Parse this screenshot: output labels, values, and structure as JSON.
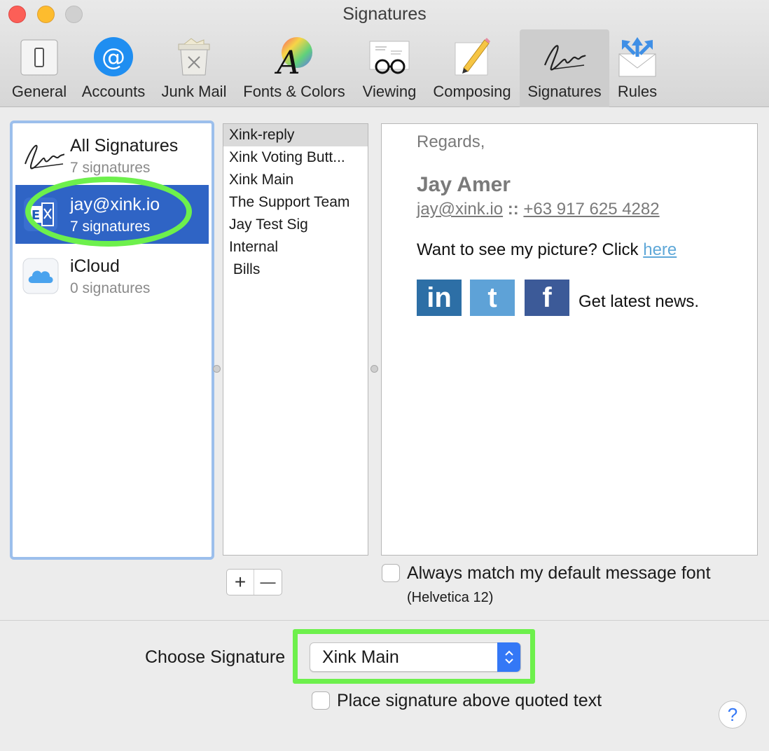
{
  "window": {
    "title": "Signatures"
  },
  "toolbar": {
    "tabs": [
      {
        "label": "General",
        "icon": "general-switch-icon"
      },
      {
        "label": "Accounts",
        "icon": "at-sign-icon"
      },
      {
        "label": "Junk Mail",
        "icon": "junk-trash-icon"
      },
      {
        "label": "Fonts & Colors",
        "icon": "font-color-wheel-icon"
      },
      {
        "label": "Viewing",
        "icon": "viewing-glasses-icon"
      },
      {
        "label": "Composing",
        "icon": "composing-pencil-icon"
      },
      {
        "label": "Signatures",
        "icon": "signature-icon",
        "selected": true
      },
      {
        "label": "Rules",
        "icon": "rules-envelope-icon"
      }
    ]
  },
  "accounts": [
    {
      "name": "All Signatures",
      "count": "7 signatures",
      "icon": "signature-icon"
    },
    {
      "name": "jay@xink.io",
      "count": "7 signatures",
      "icon": "exchange-icon",
      "selected": true
    },
    {
      "name": "iCloud",
      "count": "0 signatures",
      "icon": "icloud-icon"
    }
  ],
  "signatures": [
    {
      "label": "Xink-reply",
      "selected": true
    },
    {
      "label": "Xink Voting Butt..."
    },
    {
      "label": "Xink Main"
    },
    {
      "label": "The Support Team"
    },
    {
      "label": "Jay Test Sig"
    },
    {
      "label": "Internal"
    },
    {
      "label": " Bills"
    }
  ],
  "preview": {
    "regards": "Regards,",
    "name": "Jay Amer",
    "email": "jay@xink.io",
    "separator": "::",
    "phone": "+63 917 625 4282",
    "picture_text": "Want to see my picture? Click ",
    "picture_link": "here",
    "social": {
      "linkedin": "in",
      "twitter": "t",
      "facebook": "f"
    },
    "news": "Get latest news."
  },
  "controls": {
    "add": "+",
    "remove": "—",
    "match_font_label": "Always match my default message font",
    "match_font_sub": "(Helvetica 12)",
    "match_font_checked": false,
    "choose_label": "Choose Signature",
    "choose_value": "Xink Main",
    "place_above_label": "Place signature above quoted text",
    "place_above_checked": false,
    "help": "?"
  },
  "colors": {
    "selection": "#2f64c5",
    "accent": "#3478f6",
    "annotation_green": "#6df04c"
  }
}
